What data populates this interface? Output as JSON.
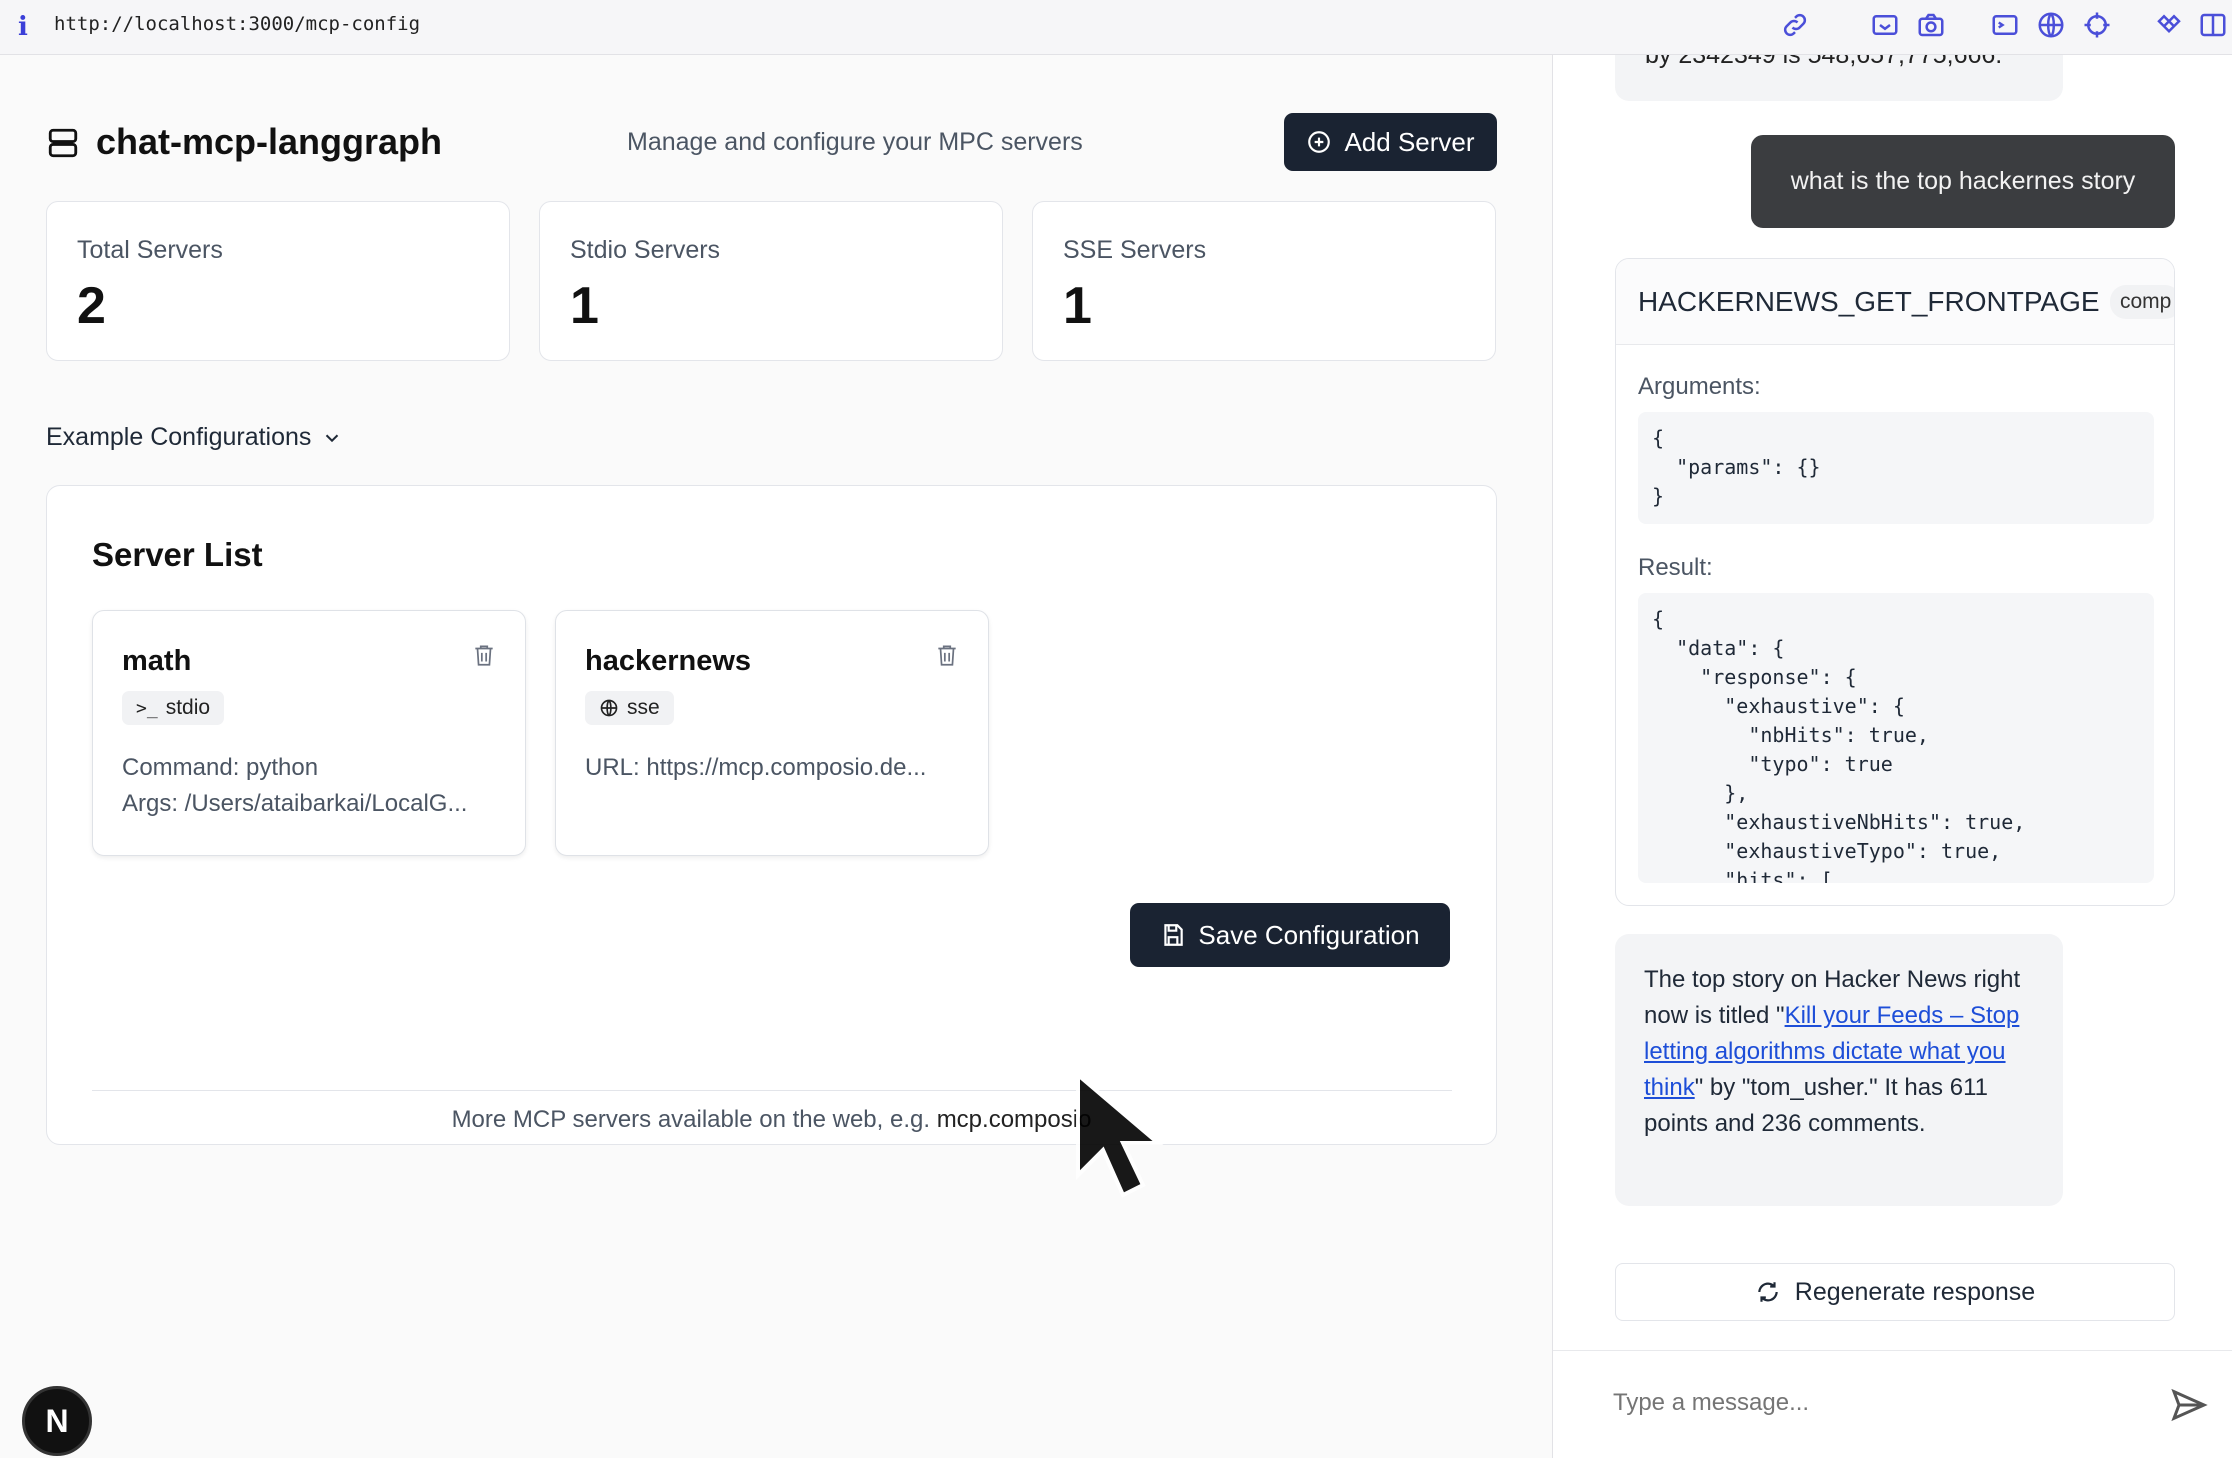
{
  "browser": {
    "info_icon": "info-icon",
    "url": "http://localhost:3000/mcp-config"
  },
  "header": {
    "title": "chat-mcp-langgraph",
    "subtitle": "Manage and configure your MPC servers",
    "add_button": "Add Server"
  },
  "stats": [
    {
      "label": "Total Servers",
      "value": "2"
    },
    {
      "label": "Stdio Servers",
      "value": "1"
    },
    {
      "label": "SSE Servers",
      "value": "1"
    }
  ],
  "examples_toggle": "Example Configurations",
  "server_list": {
    "heading": "Server List",
    "servers": [
      {
        "name": "math",
        "type": "stdio",
        "line1": "Command: python",
        "line2": "Args: /Users/ataibarkai/LocalG..."
      },
      {
        "name": "hackernews",
        "type": "sse",
        "line1": "URL: https://mcp.composio.de..."
      }
    ],
    "save_button": "Save Configuration",
    "footer_text": "More MCP servers available on the web, e.g. ",
    "footer_link": "mcp.composio"
  },
  "dev_badge": "N",
  "chat": {
    "prev_tail": "by 2342349 is 548,657,775,666.",
    "user_message": "what is the top hackernes story",
    "tool": {
      "name": "HACKERNEWS_GET_FRONTPAGE",
      "status": "comp",
      "arguments_label": "Arguments:",
      "arguments": "{\n  \"params\": {}\n}",
      "result_label": "Result:",
      "result": "{\n  \"data\": {\n    \"response\": {\n      \"exhaustive\": {\n        \"nbHits\": true,\n        \"typo\": true\n      },\n      \"exhaustiveNbHits\": true,\n      \"exhaustiveTypo\": true,\n      \"hits\": ["
    },
    "assistant": {
      "before": "The top story on Hacker News right now is titled \"",
      "link": "Kill your Feeds – Stop letting algorithms dictate what you think",
      "after": "\" by \"tom_usher.\" It has 611 points and 236 comments."
    },
    "regenerate": "Regenerate response",
    "input_placeholder": "Type a message..."
  }
}
